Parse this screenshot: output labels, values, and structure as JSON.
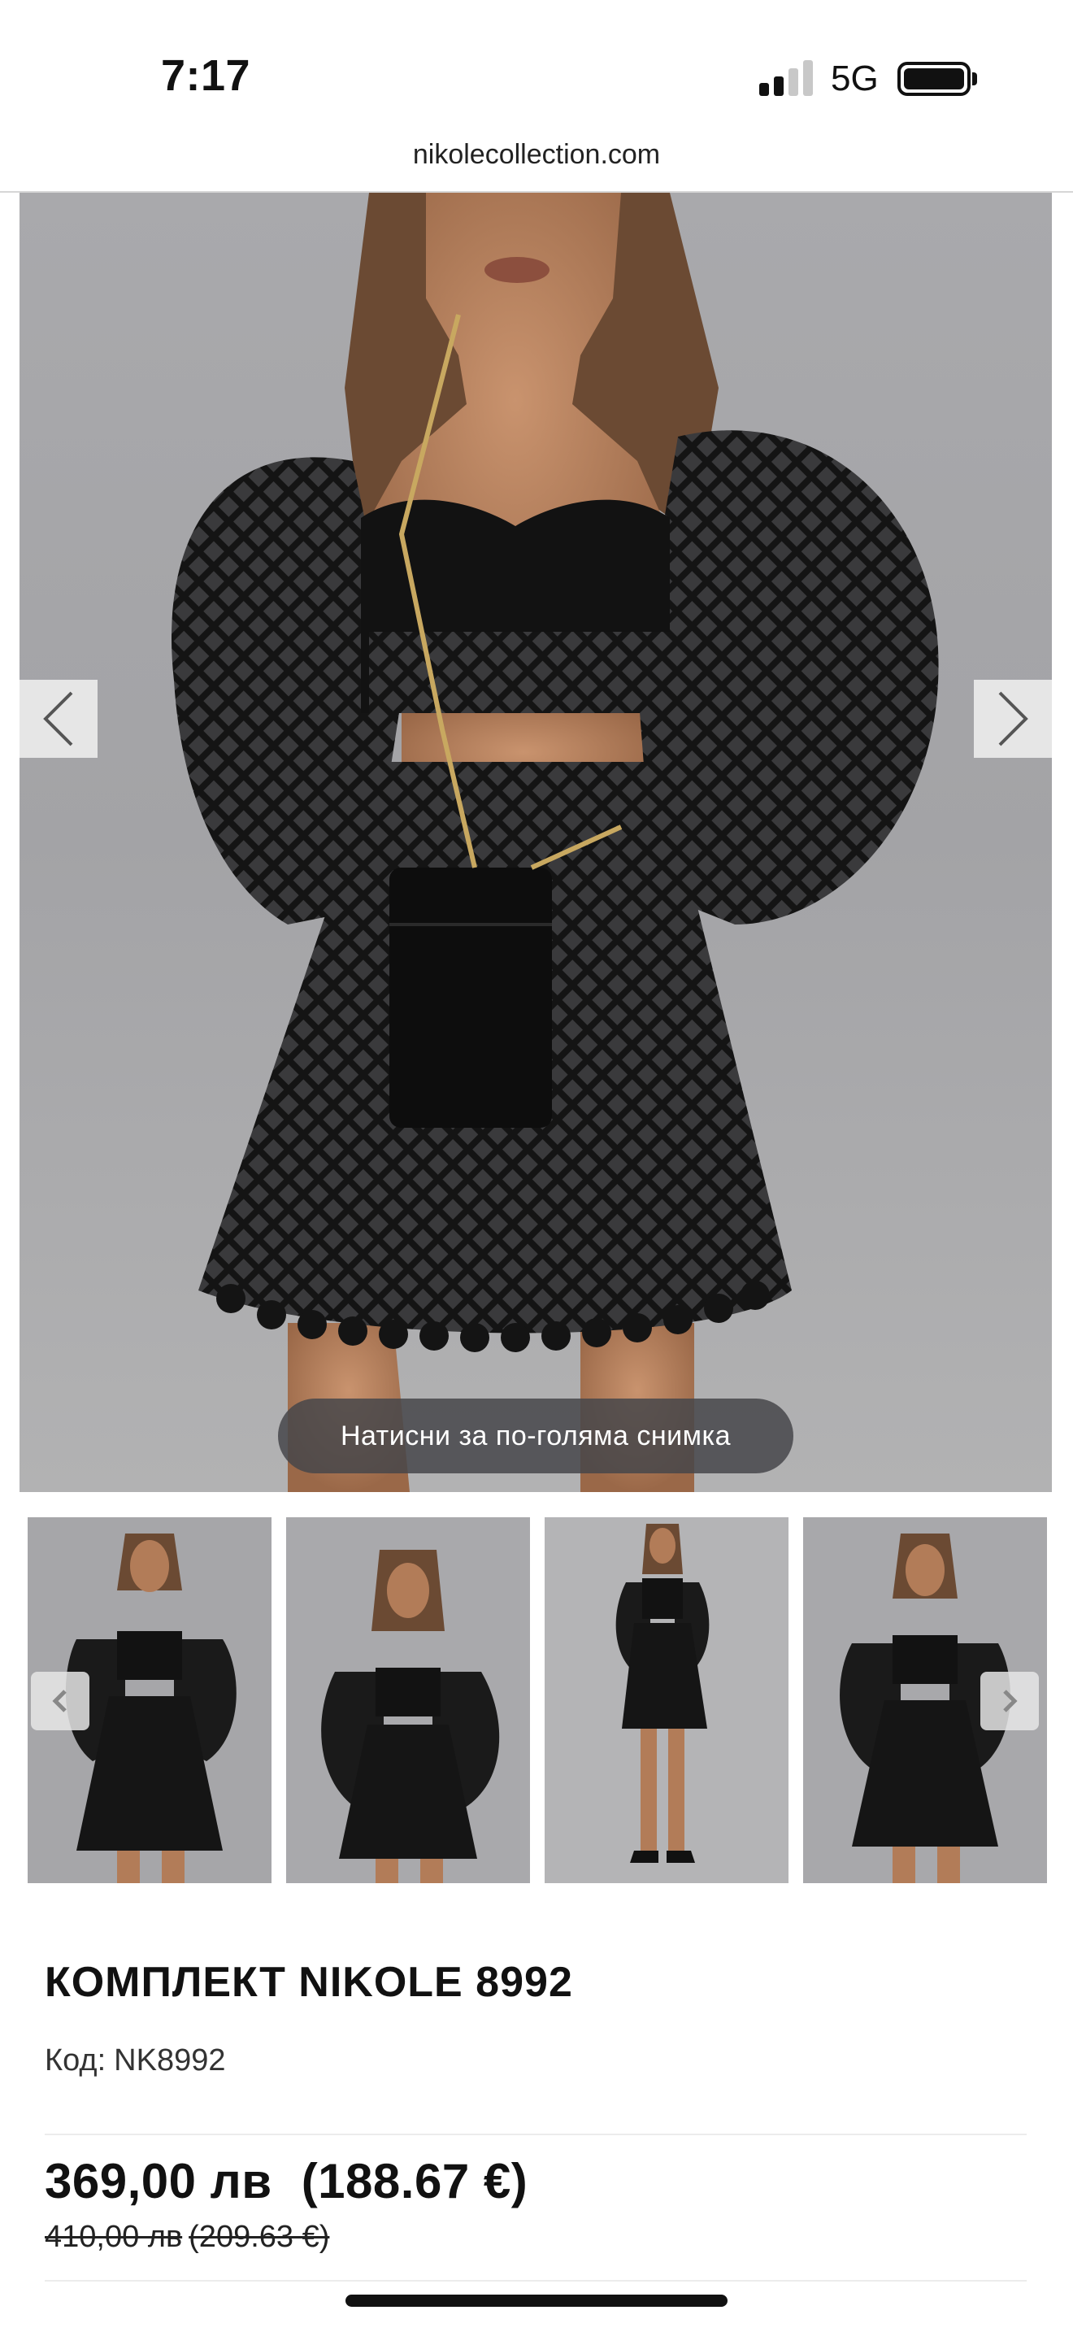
{
  "status_bar": {
    "time": "7:17",
    "network": "5G",
    "signal_bars_active": 2,
    "signal_bars_total": 4,
    "battery_level": 1.0
  },
  "browser": {
    "url": "nikolecollection.com"
  },
  "gallery": {
    "zoom_hint": "Натисни за по-голяма снимка",
    "prev_icon": "chevron-left-icon",
    "next_icon": "chevron-right-icon",
    "thumbnail_count": 4
  },
  "product": {
    "title": "КОМПЛЕКТ NIKOLE 8992",
    "code_label": "Код:",
    "code_value": "NK8992",
    "price": "369,00 лв",
    "price_eur": "(188.67 €)",
    "old_price": "410,00 лв",
    "old_price_eur": "(209.63 €)"
  },
  "colors": {
    "text": "#111111",
    "pill_bg": "#46464a",
    "photo_bg": "#a9a9ac"
  }
}
